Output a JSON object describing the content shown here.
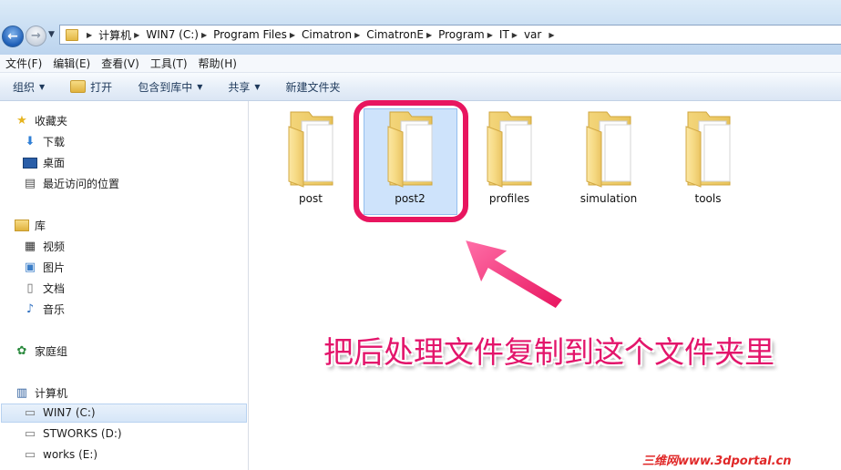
{
  "address": {
    "crumbs": [
      "计算机",
      "WIN7 (C:)",
      "Program Files",
      "Cimatron",
      "CimatronE",
      "Program",
      "IT",
      "var"
    ]
  },
  "menu": [
    "文件(F)",
    "编辑(E)",
    "查看(V)",
    "工具(T)",
    "帮助(H)"
  ],
  "toolbar": {
    "organize": "组织",
    "open": "打开",
    "include": "包含到库中",
    "share": "共享",
    "new_folder": "新建文件夹"
  },
  "sidebar": {
    "favorites": "收藏夹",
    "downloads": "下载",
    "desktop": "桌面",
    "recent": "最近访问的位置",
    "libraries": "库",
    "videos": "视频",
    "pictures": "图片",
    "documents": "文档",
    "music": "音乐",
    "homegroup": "家庭组",
    "computer": "计算机",
    "drive_c": "WIN7 (C:)",
    "drive_d": "STWORKS (D:)",
    "drive_e": "works (E:)"
  },
  "folders": [
    "post",
    "post2",
    "profiles",
    "simulation",
    "tools"
  ],
  "selected_folder": "post2",
  "annotation": "把后处理文件复制到这个文件夹里",
  "watermark": "三维网www.3dportal.cn",
  "colors": {
    "accent": "#e8155f",
    "selection": "#cde3fb"
  }
}
